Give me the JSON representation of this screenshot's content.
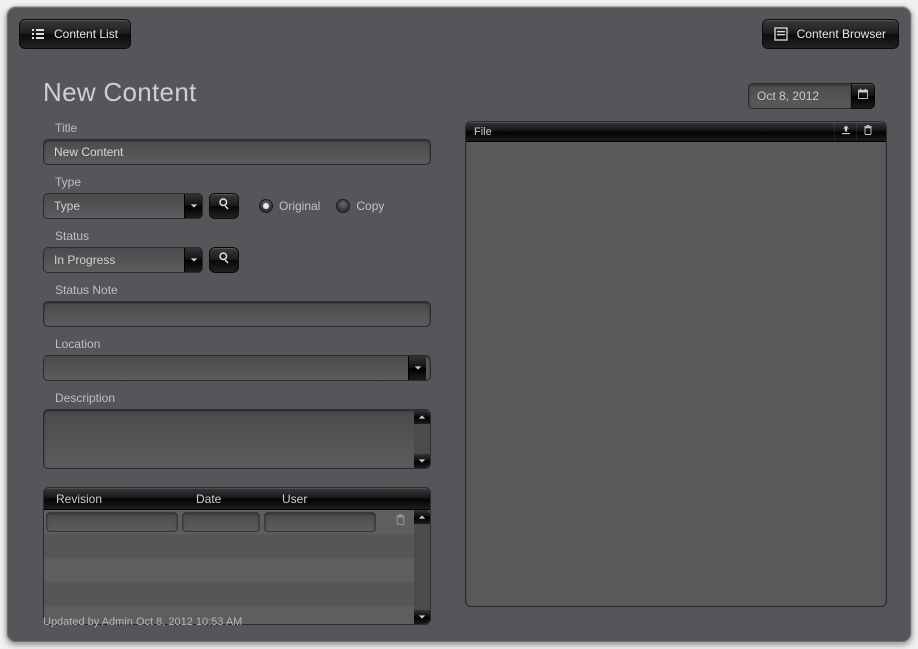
{
  "topbar": {
    "left_label": "Content List",
    "right_label": "Content Browser"
  },
  "page": {
    "title": "New Content",
    "date": "Oct 8, 2012"
  },
  "form": {
    "title_label": "Title",
    "title_value": "New Content",
    "type_label": "Type",
    "type_value": "Type",
    "origin_original_label": "Original",
    "origin_copy_label": "Copy",
    "origin_selected": "original",
    "status_label": "Status",
    "status_value": "In Progress",
    "status_note_label": "Status Note",
    "status_note_value": "",
    "location_label": "Location",
    "location_value": "",
    "description_label": "Description",
    "description_value": ""
  },
  "revisions": {
    "col_revision": "Revision",
    "col_date": "Date",
    "col_user": "User",
    "rows": [
      {
        "revision": "",
        "date": "",
        "user": ""
      }
    ]
  },
  "file_panel": {
    "header": "File"
  },
  "footer": {
    "text": "Updated by Admin Oct 8, 2012 10:53 AM"
  }
}
